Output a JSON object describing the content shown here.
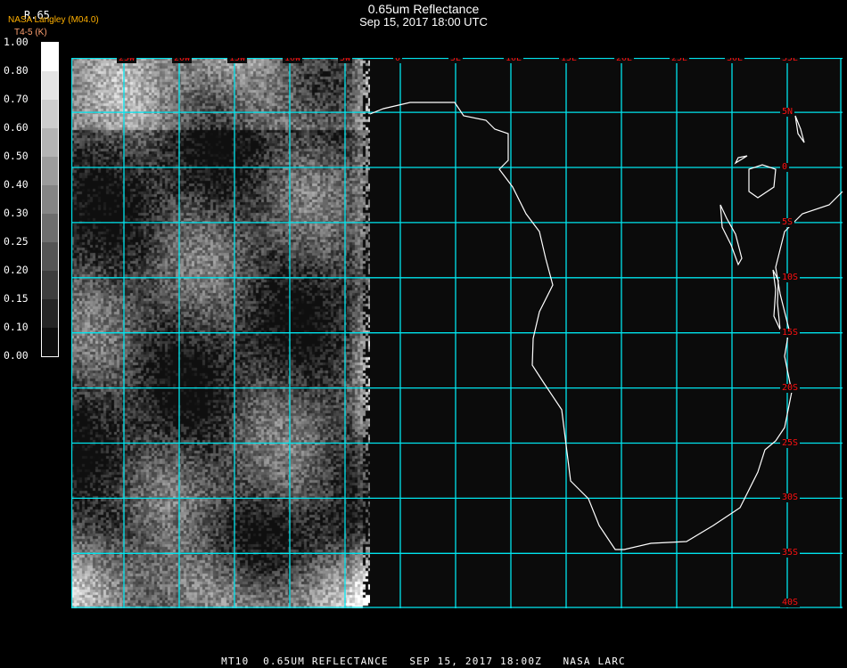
{
  "header": {
    "title": "0.65um Reflectance",
    "subtitle": "Sep 15, 2017 18:00 UTC",
    "band_label": "R.65",
    "organization": "NASA Langley (M04.0)",
    "units": "T4-5 (K)"
  },
  "colorbar": {
    "labels": [
      "1.00",
      "0.80",
      "0.70",
      "0.60",
      "0.50",
      "0.40",
      "0.30",
      "0.25",
      "0.20",
      "0.15",
      "0.10",
      "0.00"
    ],
    "colors": [
      "#ffffff",
      "#e4e4e4",
      "#cdcdcd",
      "#b4b4b4",
      "#9c9c9c",
      "#858585",
      "#6e6e6e",
      "#555555",
      "#3e3e3e",
      "#252525",
      "#0d0d0d"
    ]
  },
  "map": {
    "lon_labels": [
      "25W",
      "20W",
      "15W",
      "10W",
      "5W",
      "0",
      "5E",
      "10E",
      "15E",
      "20E",
      "25E",
      "30E",
      "35E"
    ],
    "lat_labels": [
      "5N",
      "0",
      "5S",
      "10S",
      "15S",
      "20S",
      "25S",
      "30S",
      "35S",
      "40S"
    ],
    "grid_color": "#00e5ee",
    "label_color": "#ff1010",
    "coast_color": "#ffffff"
  },
  "footer": "MT10  0.65UM REFLECTANCE   SEP 15, 2017 18:00Z   NASA LARC"
}
